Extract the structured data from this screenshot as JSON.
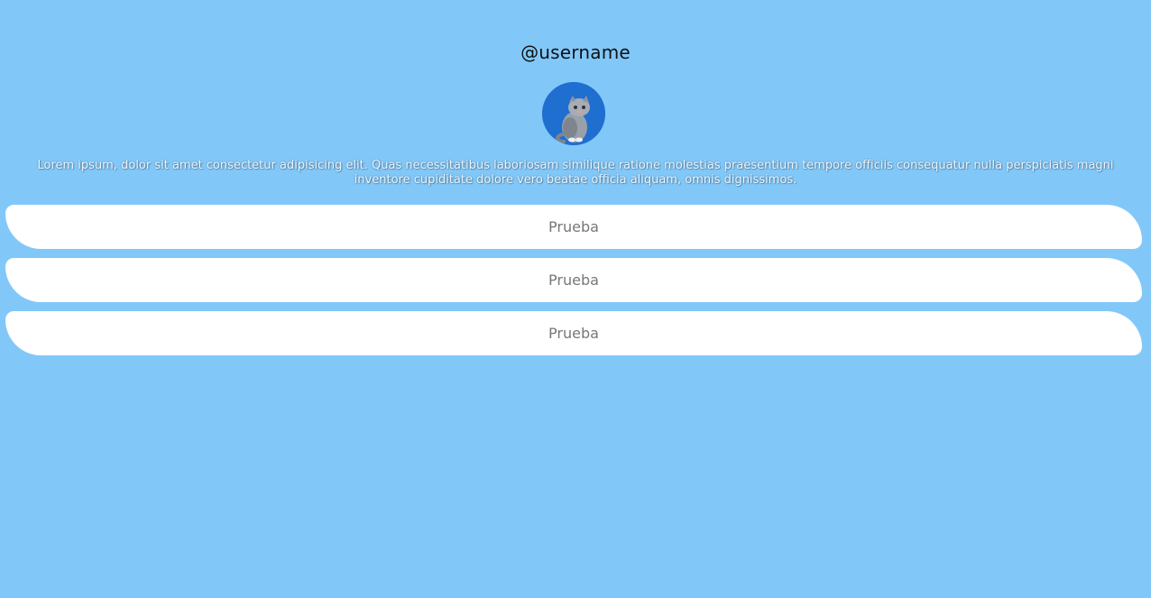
{
  "profile": {
    "username": "@username",
    "bio": "Lorem ipsum, dolor sit amet consectetur adipisicing elit. Quas necessitatibus laboriosam similique ratione molestias praesentium tempore officiis consequatur nulla perspiciatis magni inventore cupiditate dolore vero beatae officia aliquam, omnis dignissimos."
  },
  "links": [
    {
      "label": "Prueba"
    },
    {
      "label": "Prueba"
    },
    {
      "label": "Prueba"
    }
  ],
  "colors": {
    "background": "#81c8f9",
    "button": "#ffffff",
    "avatar_bg": "#1f6fd0"
  }
}
